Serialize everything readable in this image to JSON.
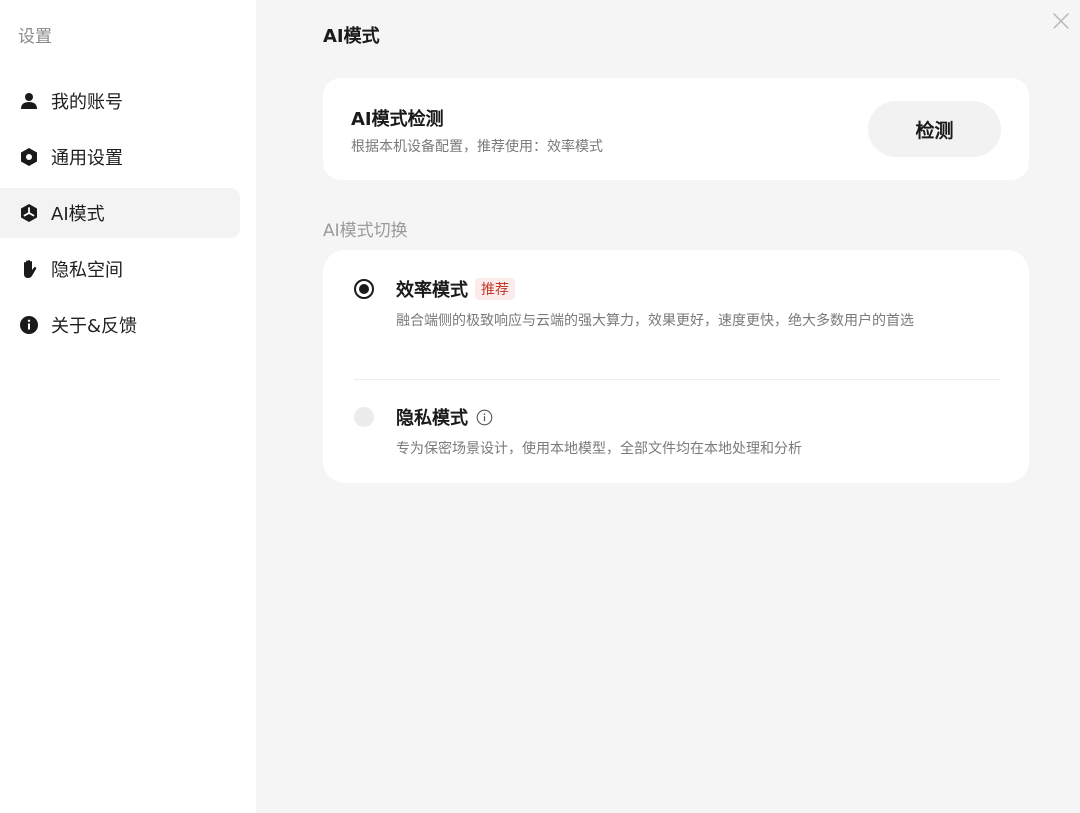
{
  "sidebar": {
    "title": "设置",
    "items": [
      {
        "label": "我的账号",
        "icon": "user-icon",
        "active": false
      },
      {
        "label": "通用设置",
        "icon": "hexagon-icon",
        "active": false
      },
      {
        "label": "AI模式",
        "icon": "ai-cube-icon",
        "active": true
      },
      {
        "label": "隐私空间",
        "icon": "hand-icon",
        "active": false
      },
      {
        "label": "关于&反馈",
        "icon": "info-icon",
        "active": false
      }
    ]
  },
  "main": {
    "title": "AI模式",
    "close_icon": "close-icon",
    "detect": {
      "title": "AI模式检测",
      "description": "根据本机设备配置，推荐使用：效率模式",
      "button_label": "检测"
    },
    "switch_section_label": "AI模式切换",
    "modes": [
      {
        "title": "效率模式",
        "badge": "推荐",
        "description": "融合端侧的极致响应与云端的强大算力，效果更好，速度更快，绝大多数用户的首选",
        "selected": true
      },
      {
        "title": "隐私模式",
        "info_icon": "info-circle-icon",
        "description": "专为保密场景设计，使用本地模型，全部文件均在本地处理和分析",
        "selected": false
      }
    ]
  },
  "colors": {
    "background": "#f5f5f5",
    "card": "#ffffff",
    "badge_text": "#c0392b",
    "badge_bg": "#fbeceb",
    "active_nav": "#f3f3f3"
  }
}
